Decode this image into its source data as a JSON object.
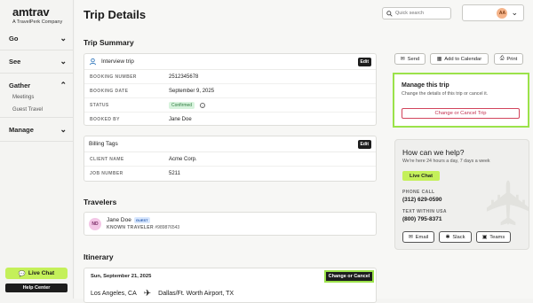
{
  "brand": {
    "name": "amtrav",
    "sub": "A TravelPerk Company"
  },
  "sidebar": {
    "sections": [
      {
        "label": "Go",
        "expanded": false
      },
      {
        "label": "See",
        "expanded": false
      },
      {
        "label": "Gather",
        "expanded": true,
        "items": [
          "Meetings",
          "Guest Travel"
        ]
      },
      {
        "label": "Manage",
        "expanded": false
      }
    ],
    "live_chat": "Live Chat",
    "help_center": "Help Center"
  },
  "header": {
    "title": "Trip Details",
    "search_placeholder": "Quick search",
    "avatar_initials": "AA"
  },
  "trip_summary": {
    "title": "Trip Summary",
    "trip_name": "Interview trip",
    "edit": "Edit",
    "rows": [
      {
        "key": "BOOKING NUMBER",
        "value": "2512345678"
      },
      {
        "key": "BOOKING DATE",
        "value": "September 9, 2025"
      },
      {
        "key": "STATUS",
        "value": "Confirmed"
      },
      {
        "key": "BOOKED BY",
        "value": "Jane Doe"
      }
    ]
  },
  "billing": {
    "title": "Billing Tags",
    "edit": "Edit",
    "rows": [
      {
        "key": "CLIENT NAME",
        "value": "Acme Corp."
      },
      {
        "key": "JOB NUMBER",
        "value": "5211"
      }
    ]
  },
  "travelers": {
    "title": "Travelers",
    "initials": "ND",
    "name": "Jane Doe",
    "badge": "GUEST",
    "known_label": "KNOWN TRAVELER",
    "known_value": "#989876543"
  },
  "itinerary": {
    "title": "Itinerary",
    "date": "Sun, September 21, 2025",
    "change_btn": "Change or Cancel",
    "origin": "Los Angeles, CA",
    "destination": "Dallas/Ft. Worth Airport, TX"
  },
  "actions": {
    "send": "Send",
    "calendar": "Add to Calendar",
    "print": "Print"
  },
  "manage": {
    "title": "Manage this trip",
    "subtitle": "Change the details of this trip or cancel it.",
    "button": "Change or Cancel Trip"
  },
  "help": {
    "title": "How can we help?",
    "subtitle": "We're here 24 hours a day, 7 days a week",
    "live_chat": "Live Chat",
    "phone_label": "PHONE CALL",
    "phone": "(312) 629-0590",
    "text_label": "TEXT WITHIN USA",
    "text": "(800) 795-8371",
    "email": "Email",
    "slack": "Slack",
    "teams": "Teams"
  },
  "colors": {
    "accent": "#c4f05a",
    "highlight": "#9be24a",
    "danger": "#c23050"
  }
}
